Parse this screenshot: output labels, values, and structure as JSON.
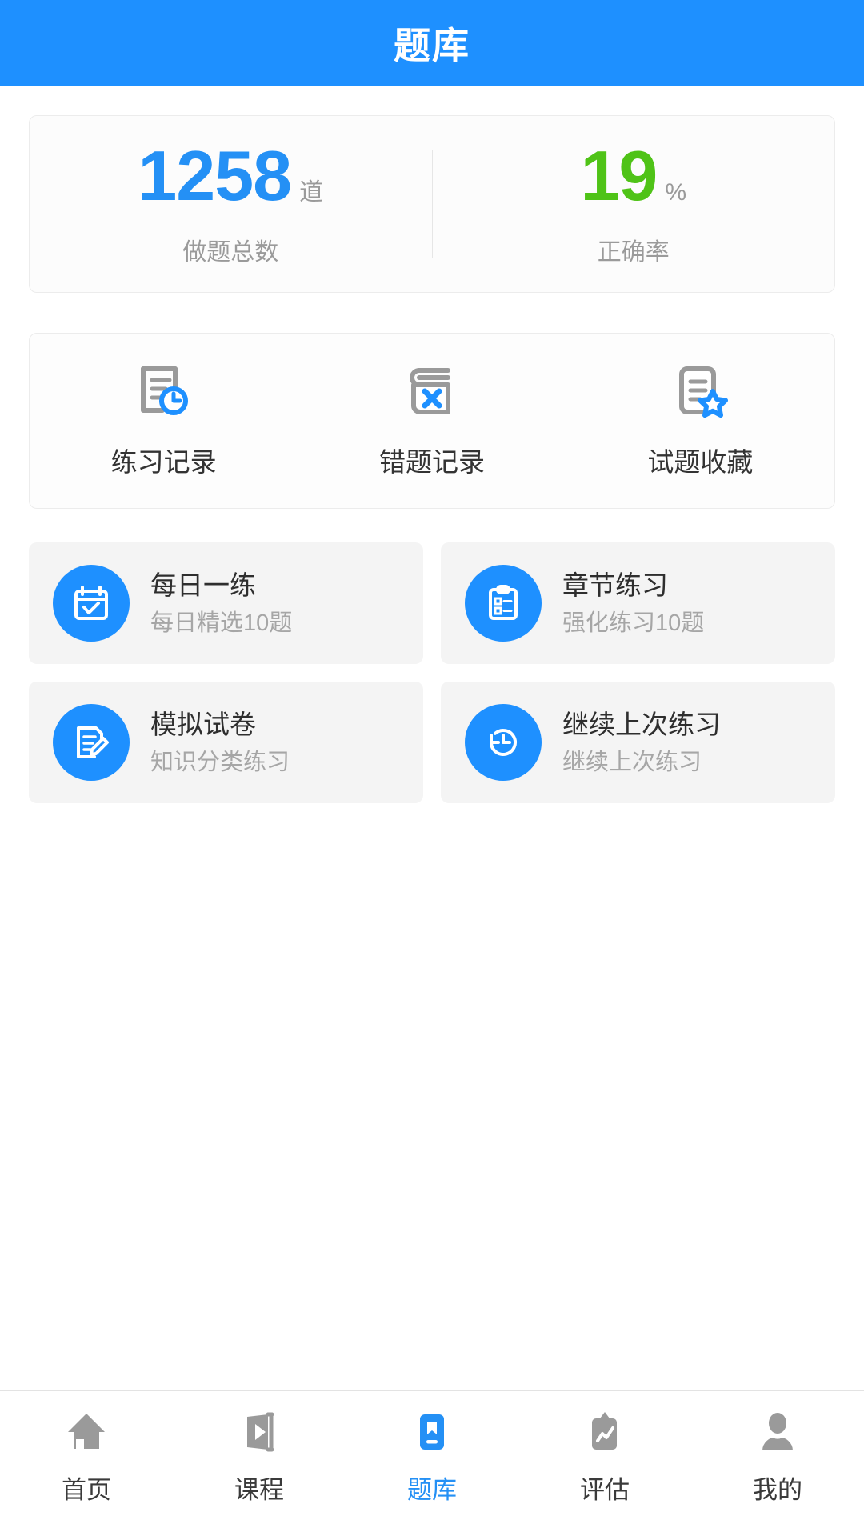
{
  "header": {
    "title": "题库"
  },
  "stats": {
    "items": [
      {
        "value": "1258",
        "unit": "道",
        "label": "做题总数",
        "color": "#2490f5"
      },
      {
        "value": "19",
        "unit": "%",
        "label": "正确率",
        "color": "#4fc317"
      }
    ]
  },
  "quick_links": {
    "items": [
      {
        "label": "练习记录",
        "icon": "document-clock-icon"
      },
      {
        "label": "错题记录",
        "icon": "book-cross-icon"
      },
      {
        "label": "试题收藏",
        "icon": "document-star-icon"
      }
    ]
  },
  "tiles": {
    "items": [
      {
        "title": "每日一练",
        "subtitle": "每日精选10题",
        "icon": "calendar-check-icon"
      },
      {
        "title": "章节练习",
        "subtitle": "强化练习10题",
        "icon": "clipboard-list-icon"
      },
      {
        "title": "模拟试卷",
        "subtitle": "知识分类练习",
        "icon": "document-pencil-icon"
      },
      {
        "title": "继续上次练习",
        "subtitle": "继续上次练习",
        "icon": "history-clock-icon"
      }
    ]
  },
  "bottom_nav": {
    "items": [
      {
        "label": "首页",
        "icon": "home-icon",
        "active": false
      },
      {
        "label": "课程",
        "icon": "video-play-icon",
        "active": false
      },
      {
        "label": "题库",
        "icon": "bookmark-square-icon",
        "active": true
      },
      {
        "label": "评估",
        "icon": "clipboard-chart-icon",
        "active": false
      },
      {
        "label": "我的",
        "icon": "person-icon",
        "active": false
      }
    ]
  },
  "colors": {
    "primary": "#1e90ff",
    "accent_blue": "#2490f5",
    "accent_green": "#4fc317",
    "tile_bg": "#f4f4f4",
    "muted_text": "#9a9a9a",
    "icon_gray": "#999999"
  }
}
